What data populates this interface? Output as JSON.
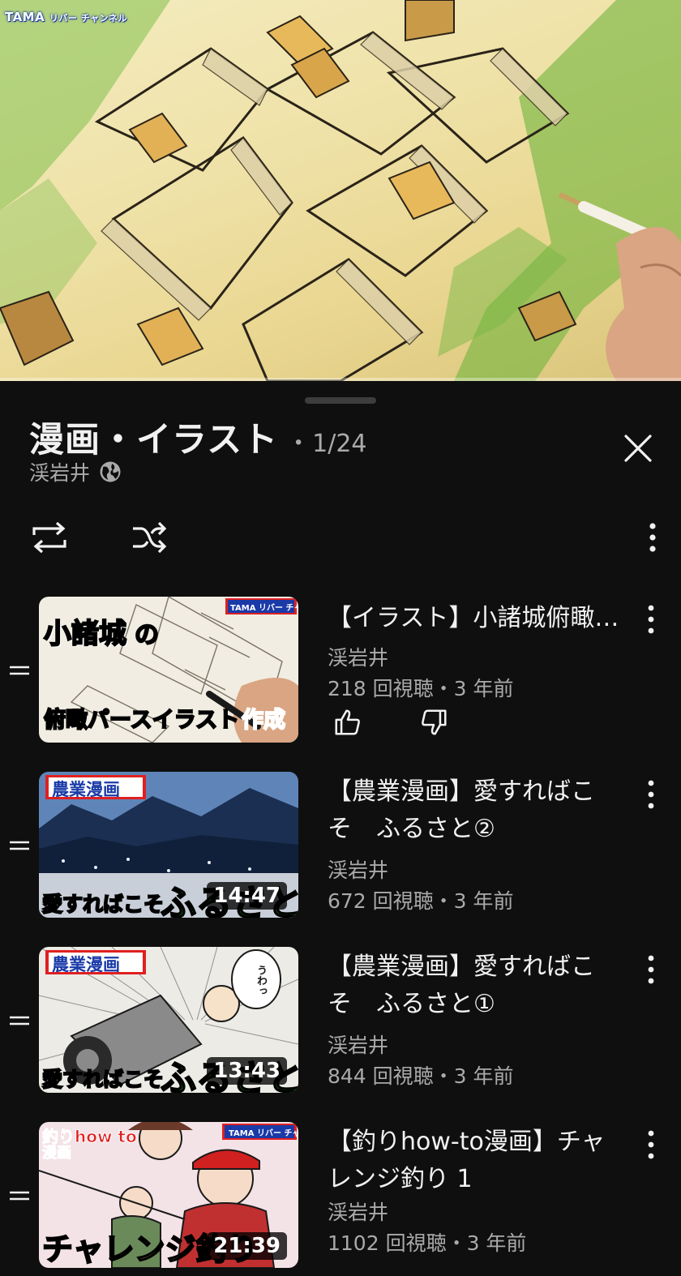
{
  "player": {
    "watermark_brand": "TAMA",
    "watermark_sub": "リバー チャンネル",
    "progress_fraction": 0.0
  },
  "playlist": {
    "title": "漫画・イラスト",
    "separator": "・",
    "position": "1/24",
    "owner": "渓岩井",
    "icons": {
      "owner": "globe-icon",
      "close": "close-icon",
      "loop": "loop-icon",
      "shuffle": "shuffle-icon",
      "more": "more-vert-icon"
    }
  },
  "items": [
    {
      "title": "【イラスト】小諸城俯瞰パースイラスト作成",
      "channel": "渓岩井",
      "meta": "218 回視聴・3 年前",
      "thumb_text_1": "小諸城",
      "thumb_text_1b": "の",
      "thumb_text_2": "俯瞰パースイラスト",
      "thumb_text_3": "作成",
      "thumb_badge": "TAMA リバー チャンネル",
      "like_icon": "thumb-up-icon",
      "dislike_icon": "thumb-down-icon"
    },
    {
      "title_line1": "【農業漫画】愛すればこ",
      "title_line2": "そ　ふるさと②",
      "channel": "渓岩井",
      "meta": "672 回視聴・3 年前",
      "duration": "14:47",
      "thumb_label": "農業漫画",
      "thumb_text_a": "愛すればこそ",
      "thumb_text_b": "ふるさと"
    },
    {
      "title_line1": "【農業漫画】愛すればこ",
      "title_line2": "そ　ふるさと①",
      "channel": "渓岩井",
      "meta": "844 回視聴・3 年前",
      "duration": "13:43",
      "thumb_label": "農業漫画",
      "thumb_text_a": "愛すればこそ",
      "thumb_text_b": "ふるさと",
      "thumb_bubble": "うわっ"
    },
    {
      "title_line1": "【釣りhow-to漫画】チャ",
      "title_line2": "レンジ釣り 1",
      "channel": "渓岩井",
      "meta": "1102 回視聴・3 年前",
      "duration": "21:39",
      "thumb_label_a": "釣りhow to",
      "thumb_label_b": "漫画",
      "thumb_text": "チャレンジ釣り",
      "thumb_badge": "TAMA リバー チャンネル"
    }
  ],
  "colors": {
    "background": "#0f0f0f",
    "text_primary": "#f1f1f1",
    "text_secondary": "#aaaaaa",
    "progress": "#ff0000"
  }
}
